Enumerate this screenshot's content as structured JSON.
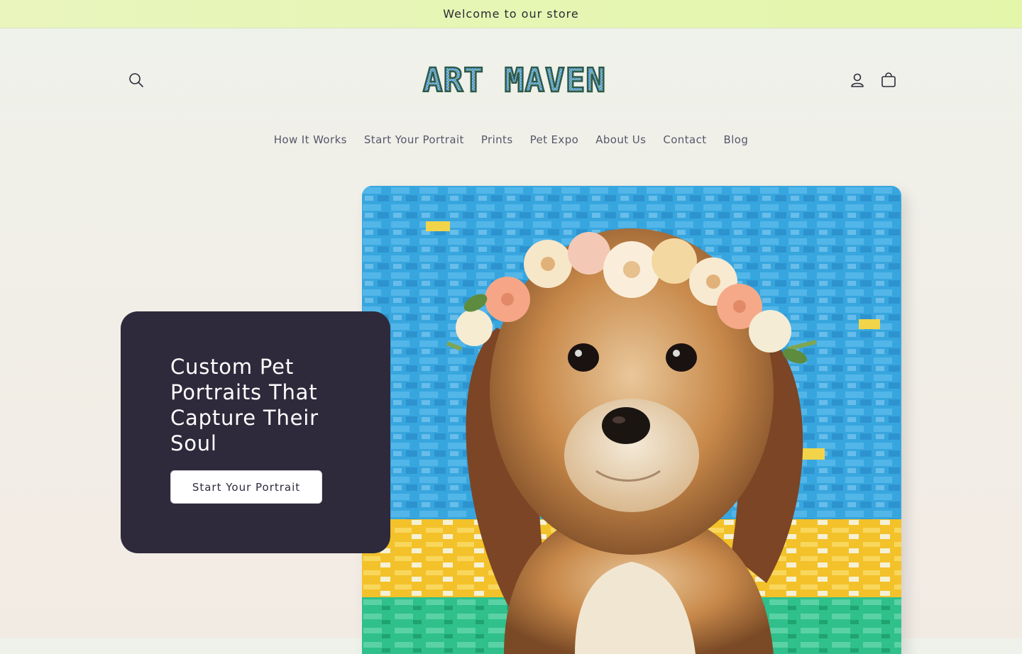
{
  "announcement": {
    "text": "Welcome to our store"
  },
  "header": {
    "logo_text": "ART MAVEN",
    "icons": {
      "search": "search-icon",
      "account": "account-icon",
      "cart": "cart-icon"
    }
  },
  "nav": {
    "items": [
      {
        "label": "How It Works"
      },
      {
        "label": "Start Your Portrait"
      },
      {
        "label": "Prints"
      },
      {
        "label": "Pet Expo"
      },
      {
        "label": "About Us"
      },
      {
        "label": "Contact"
      },
      {
        "label": "Blog"
      }
    ]
  },
  "hero": {
    "heading": "Custom Pet Portraits That Capture Their Soul",
    "button_label": "Start Your Portrait",
    "image_description_icon": "puppy-portrait-painting"
  },
  "colors": {
    "announcement_bg": "#e6f5b3",
    "card_bg": "#2e2a3b",
    "logo_fill": "#4d9ad6",
    "logo_outline": "#2f5a4a"
  }
}
